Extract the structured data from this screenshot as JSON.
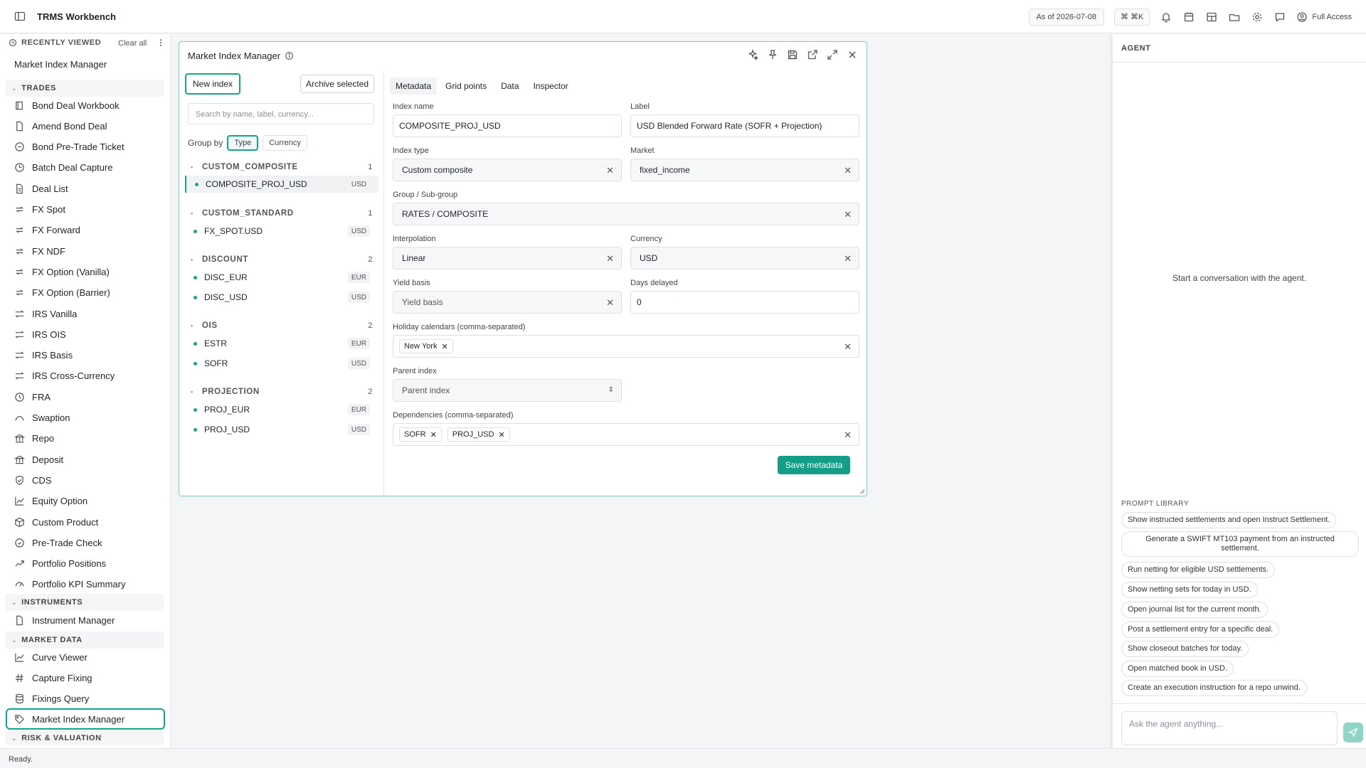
{
  "app": {
    "title": "TRMS Workbench",
    "as_of": "As of 2026-07-08",
    "shortcut": "⌘ ⌘K",
    "access": "Full Access"
  },
  "sidebar": {
    "recent_title": "RECENTLY VIEWED",
    "clear_all": "Clear all",
    "recent_items": [
      "Market Index Manager"
    ],
    "sections": {
      "trades": "TRADES",
      "instruments": "INSTRUMENTS",
      "market_data": "MARKET DATA",
      "risk": "RISK & VALUATION"
    },
    "trades": [
      "Bond Deal Workbook",
      "Amend Bond Deal",
      "Bond Pre-Trade Ticket",
      "Batch Deal Capture",
      "Deal List",
      "FX Spot",
      "FX Forward",
      "FX NDF",
      "FX Option (Vanilla)",
      "FX Option (Barrier)",
      "IRS Vanilla",
      "IRS OIS",
      "IRS Basis",
      "IRS Cross-Currency",
      "FRA",
      "Swaption",
      "Repo",
      "Deposit",
      "CDS",
      "Equity Option",
      "Custom Product",
      "Pre-Trade Check",
      "Portfolio Positions",
      "Portfolio KPI Summary"
    ],
    "instruments": [
      "Instrument Manager"
    ],
    "market_data": [
      "Curve Viewer",
      "Capture Fixing",
      "Fixings Query",
      "Market Index Manager"
    ]
  },
  "window": {
    "title": "Market Index Manager",
    "new_index": "New index",
    "archive_selected": "Archive selected",
    "search_placeholder": "Search by name, label, currency...",
    "group_by": "Group by",
    "group_type": "Type",
    "group_currency": "Currency",
    "groups": [
      {
        "name": "CUSTOM_COMPOSITE",
        "count": "1",
        "items": [
          {
            "name": "COMPOSITE_PROJ_USD",
            "ccy": "USD"
          }
        ]
      },
      {
        "name": "CUSTOM_STANDARD",
        "count": "1",
        "items": [
          {
            "name": "FX_SPOT.USD",
            "ccy": "USD"
          }
        ]
      },
      {
        "name": "DISCOUNT",
        "count": "2",
        "items": [
          {
            "name": "DISC_EUR",
            "ccy": "EUR"
          },
          {
            "name": "DISC_USD",
            "ccy": "USD"
          }
        ]
      },
      {
        "name": "OIS",
        "count": "2",
        "items": [
          {
            "name": "ESTR",
            "ccy": "EUR"
          },
          {
            "name": "SOFR",
            "ccy": "USD"
          }
        ]
      },
      {
        "name": "PROJECTION",
        "count": "2",
        "items": [
          {
            "name": "PROJ_EUR",
            "ccy": "EUR"
          },
          {
            "name": "PROJ_USD",
            "ccy": "USD"
          }
        ]
      }
    ],
    "tabs": [
      "Metadata",
      "Grid points",
      "Data",
      "Inspector"
    ],
    "form": {
      "index_name_label": "Index name",
      "index_name": "COMPOSITE_PROJ_USD",
      "label_label": "Label",
      "label": "USD Blended Forward Rate (SOFR + Projection)",
      "index_type_label": "Index type",
      "index_type": "Custom composite",
      "market_label": "Market",
      "market": "fixed_income",
      "group_label": "Group / Sub-group",
      "group": "RATES / COMPOSITE",
      "interp_label": "Interpolation",
      "interp": "Linear",
      "currency_label": "Currency",
      "currency": "USD",
      "yield_label": "Yield basis",
      "yield": "Yield basis",
      "days_label": "Days delayed",
      "days": "0",
      "holiday_label": "Holiday calendars (comma-separated)",
      "holidays": [
        "New York"
      ],
      "parent_label": "Parent index",
      "parent": "Parent index",
      "deps_label": "Dependencies (comma-separated)",
      "deps": [
        "SOFR",
        "PROJ_USD"
      ],
      "save": "Save metadata"
    }
  },
  "agent": {
    "title": "AGENT",
    "empty": "Start a conversation with the agent.",
    "prompt_library": "PROMPT LIBRARY",
    "prompts": [
      "Show instructed settlements and open Instruct Settlement.",
      "Generate a SWIFT MT103 payment from an instructed settlement.",
      "Run netting for eligible USD settlements.",
      "Show netting sets for today in USD.",
      "Open journal list for the current month.",
      "Post a settlement entry for a specific deal.",
      "Show closeout batches for today.",
      "Open matched book in USD.",
      "Create an execution instruction for a repo unwind."
    ],
    "ask_placeholder": "Ask the agent anything..."
  },
  "status": "Ready."
}
